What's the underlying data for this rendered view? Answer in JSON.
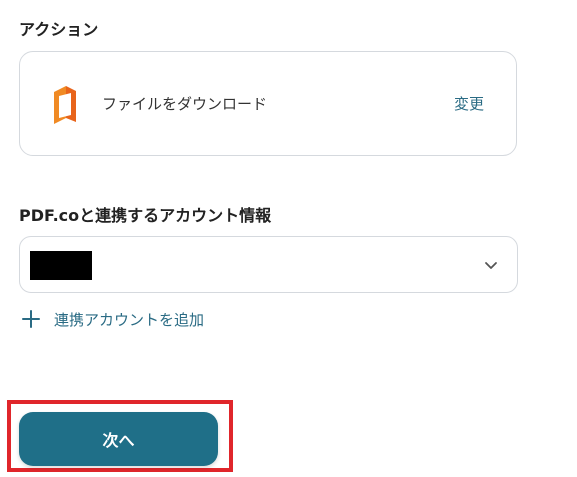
{
  "action_section": {
    "title": "アクション",
    "app_icon": "office-document-icon",
    "action_label": "ファイルをダウンロード",
    "change_label": "変更"
  },
  "account_section": {
    "title": "PDF.coと連携するアカウント情報",
    "selected_value_redacted": true,
    "add_account_label": "連携アカウントを追加"
  },
  "footer": {
    "next_label": "次へ"
  },
  "colors": {
    "accent": "#2a6b84",
    "primary_button": "#1f6f88",
    "highlight": "#e0262b",
    "icon_orange": "#e8641b"
  }
}
